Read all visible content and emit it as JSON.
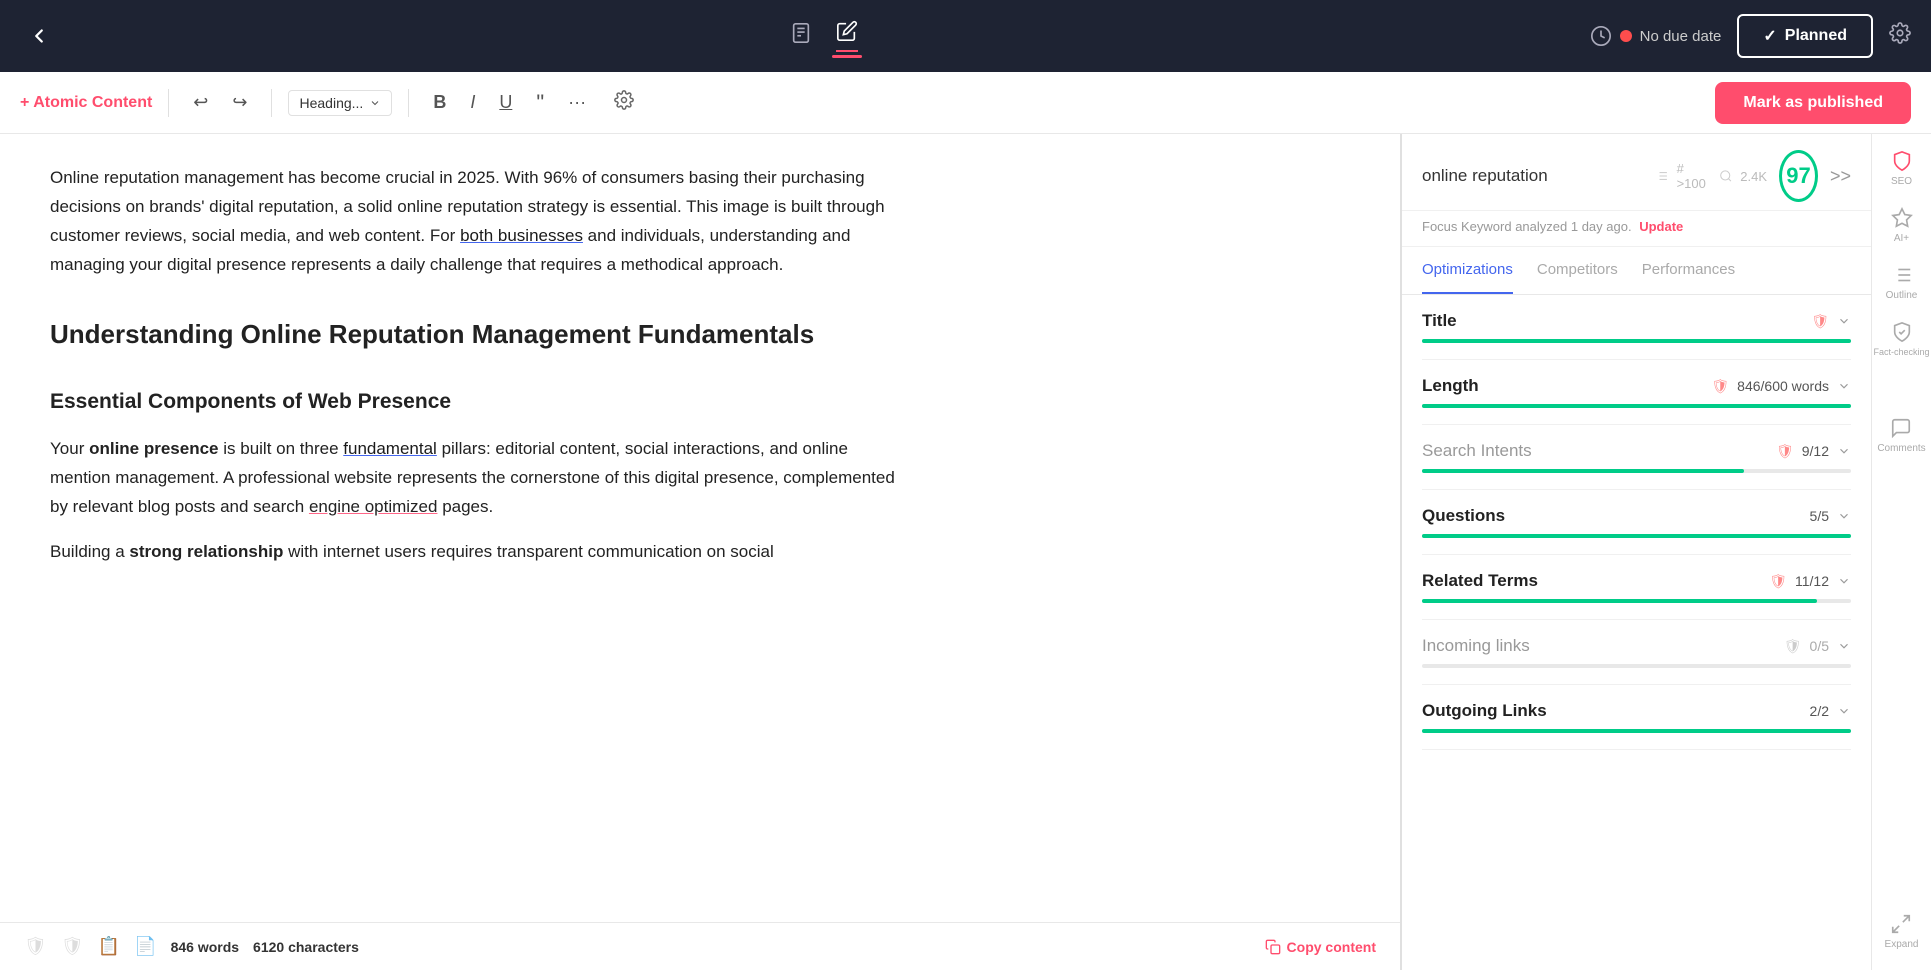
{
  "topNav": {
    "backLabel": "←",
    "docIcon": "📄",
    "editIcon": "✏️",
    "noduedateLabel": "No due date",
    "plannedLabel": "Planned",
    "checkmark": "✓"
  },
  "toolbar": {
    "brandLabel": "+ Atomic Content",
    "undoLabel": "↩",
    "redoLabel": "↪",
    "headingLabel": "Heading...",
    "boldLabel": "B",
    "italicLabel": "I",
    "underlineLabel": "U",
    "quoteLabel": "\"",
    "moreLabel": "···",
    "markPublishedLabel": "Mark as published",
    "gearLabel": "⚙"
  },
  "editor": {
    "paragraph1": "Online reputation management has become crucial in 2025. With 96% of consumers basing their purchasing decisions on brands' digital reputation, a solid online reputation strategy is essential. This image is built through customer reviews, social media, and web content. For both businesses and individuals, understanding and managing your digital presence represents a daily challenge that requires a methodical approach.",
    "heading1": "Understanding Online Reputation Management Fundamentals",
    "heading2": "Essential Components of Web Presence",
    "paragraph2": "Your online presence is built on three fundamental pillars: editorial content, social interactions, and online mention management. A professional website represents the cornerstone of this digital presence, complemented by relevant blog posts and search engine optimized pages.",
    "paragraph3": "Building a strong relationship with internet users requires transparent communication on social"
  },
  "statusBar": {
    "wordCount": "846",
    "charCount": "6120",
    "wordsLabel": "words",
    "charsLabel": "characters",
    "copyLabel": "Copy content"
  },
  "sidebar": {
    "keyword": "online reputation",
    "hashLabel": "# >100",
    "volume": "2.4K",
    "score": "97",
    "analyzedText": "Focus Keyword analyzed 1 day ago.",
    "updateLabel": "Update",
    "tabs": [
      "Optimizations",
      "Competitors",
      "Performances"
    ],
    "activeTab": "Optimizations",
    "items": [
      {
        "label": "Title",
        "count": "",
        "countLabel": "",
        "shield": true,
        "shieldColor": "light",
        "progressPct": 100,
        "progressColor": "green"
      },
      {
        "label": "Length",
        "count": "846/600 words",
        "shield": true,
        "shieldColor": "light",
        "progressPct": 100,
        "progressColor": "green"
      },
      {
        "label": "Search Intents",
        "count": "9/12",
        "shield": true,
        "shieldColor": "pink",
        "progressPct": 75,
        "progressColor": "green",
        "light": true
      },
      {
        "label": "Questions",
        "count": "5/5",
        "shield": false,
        "progressPct": 100,
        "progressColor": "green"
      },
      {
        "label": "Related Terms",
        "count": "11/12",
        "shield": true,
        "shieldColor": "pink",
        "progressPct": 92,
        "progressColor": "green"
      },
      {
        "label": "Incoming links",
        "count": "0/5",
        "shield": true,
        "shieldColor": "light",
        "progressPct": 0,
        "progressColor": "green",
        "light": true
      },
      {
        "label": "Outgoing Links",
        "count": "2/2",
        "shield": false,
        "progressPct": 100,
        "progressColor": "green"
      }
    ],
    "sideIcons": [
      {
        "icon": "🔗",
        "label": "SEO",
        "active": true
      },
      {
        "icon": "✏️",
        "label": "AI+",
        "active": false
      },
      {
        "icon": "≡",
        "label": "Outline",
        "active": false
      },
      {
        "icon": "🛡",
        "label": "Fact-checking",
        "active": false
      },
      {
        "icon": "💬",
        "label": "Comments",
        "active": false
      }
    ],
    "expandLabel": "↔",
    "expandSubLabel": "Expand"
  }
}
